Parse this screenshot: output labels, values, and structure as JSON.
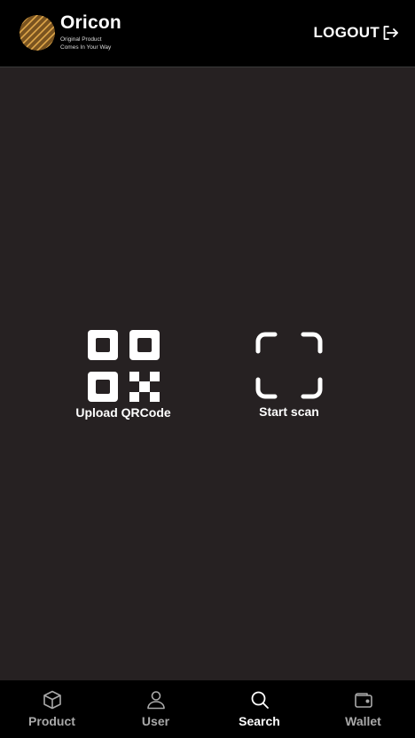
{
  "header": {
    "brand_name": "Oricon",
    "tagline_line1": "Original Product",
    "tagline_line2": "Comes In Your Way",
    "logout_label": "LOGOUT"
  },
  "main": {
    "upload_label": "Upload QRCode",
    "scan_label": "Start scan"
  },
  "bottom_nav": {
    "items": [
      {
        "label": "Product",
        "icon": "cube-icon"
      },
      {
        "label": "User",
        "icon": "user-icon"
      },
      {
        "label": "Search",
        "icon": "search-icon",
        "active": true
      },
      {
        "label": "Wallet",
        "icon": "wallet-icon"
      }
    ]
  },
  "colors": {
    "header_bg": "#000000",
    "main_bg": "#262122",
    "nav_bg": "#000000",
    "logo_gold": "#c8913a",
    "active_text": "#ffffff",
    "inactive_text": "#a9a9a9"
  }
}
